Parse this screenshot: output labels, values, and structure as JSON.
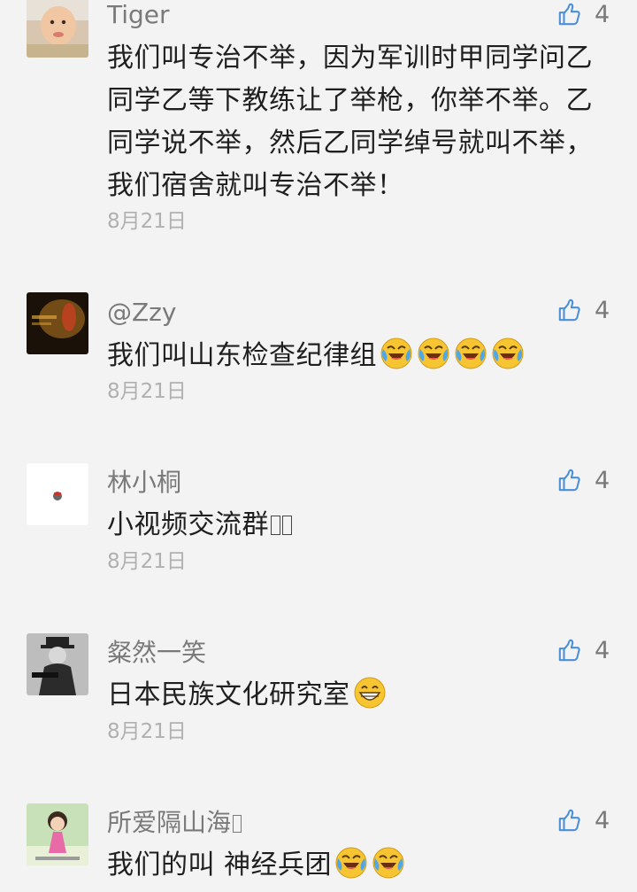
{
  "comments": [
    {
      "username": "Tiger",
      "text": "我们叫专治不举，因为军训时甲同学问乙同学乙等下教练让了举枪，你举不举。乙同学说不举，然后乙同学绰号就叫不举，我们宿舍就叫专治不举！",
      "date": "8月21日",
      "likes": "4"
    },
    {
      "username": "@Zzy",
      "text": "我们叫山东检查纪律组",
      "emoji": [
        "laughing-crying-emoji",
        "laughing-crying-emoji",
        "laughing-crying-emoji",
        "laughing-crying-emoji"
      ],
      "date": "8月21日",
      "likes": "4"
    },
    {
      "username": "林小桐",
      "text": "小视频交流群",
      "date": "8月21日",
      "likes": "4"
    },
    {
      "username": "粲然一笑",
      "text": "日本民族文化研究室",
      "emoji": [
        "grinning-emoji"
      ],
      "date": "8月21日",
      "likes": "4"
    },
    {
      "username": "所爱隔山海",
      "text": "我们的叫 神经兵团",
      "emoji": [
        "laughing-crying-emoji",
        "laughing-crying-emoji"
      ],
      "likes": "4"
    }
  ],
  "colors": {
    "background": "#f3f3f3",
    "username": "#7a7a7a",
    "text": "#1f1f1f",
    "date": "#b0b0b0",
    "like_icon": "#4a8fd8",
    "emoji_face": "#f6c531"
  }
}
